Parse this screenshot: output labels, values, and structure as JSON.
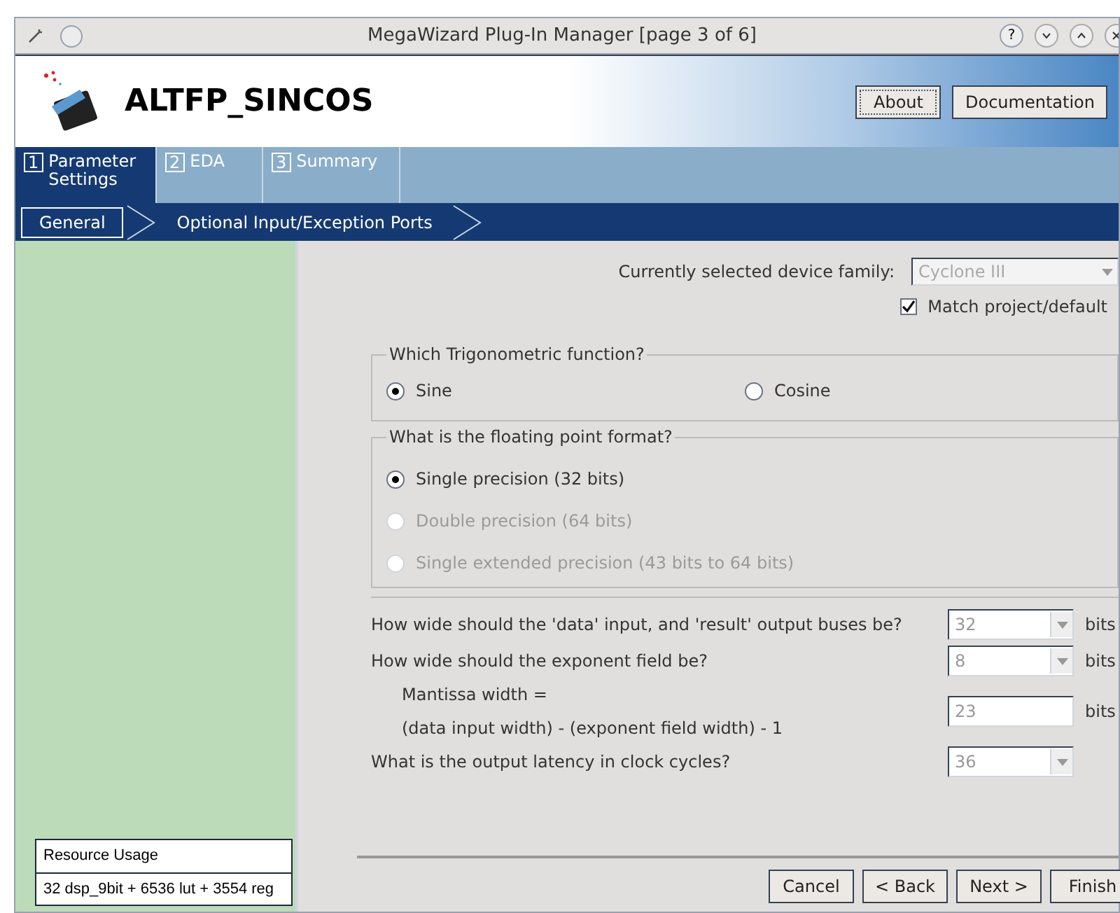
{
  "window": {
    "title": "MegaWizard Plug-In Manager [page 3 of 6]",
    "help": "?"
  },
  "header": {
    "title": "ALTFP_SINCOS",
    "buttons": [
      {
        "label": "About",
        "focused": true
      },
      {
        "label": "Documentation",
        "focused": false
      }
    ]
  },
  "tabs": [
    {
      "number": "1",
      "label": "Parameter Settings",
      "selected": true
    },
    {
      "number": "2",
      "label": "EDA",
      "selected": false
    },
    {
      "number": "3",
      "label": "Summary",
      "selected": false
    }
  ],
  "subtabs": [
    {
      "label": "General",
      "selected": true
    },
    {
      "label": "Optional Input/Exception Ports",
      "selected": false
    }
  ],
  "device": {
    "label": "Currently selected device family:",
    "value": "Cyclone III",
    "match_label": "Match project/default",
    "checked": true
  },
  "groups": [
    {
      "title": "Which Trigonometric function?",
      "kind": "row",
      "options": [
        {
          "label": "Sine",
          "selected": true,
          "disabled": false
        },
        {
          "label": "Cosine",
          "selected": false,
          "disabled": false
        }
      ]
    },
    {
      "title": "What is the floating point format?",
      "kind": "column",
      "options": [
        {
          "label": "Single precision (32 bits)",
          "selected": true,
          "disabled": false
        },
        {
          "label": "Double precision (64 bits)",
          "selected": false,
          "disabled": true
        },
        {
          "label": "Single extended precision (43 bits to 64 bits)",
          "selected": false,
          "disabled": true
        }
      ]
    }
  ],
  "settings": [
    {
      "kind": "dropdown",
      "label": "How wide should the 'data' input, and 'result' output buses be?",
      "value": "32",
      "unit": "bits",
      "disabled": true
    },
    {
      "kind": "dropdown",
      "label": "How wide should the exponent field be?",
      "value": "8",
      "unit": "bits",
      "disabled": true
    },
    {
      "kind": "text",
      "label": "Mantissa width =",
      "label2": "(data input width) - (exponent field width) - 1",
      "value": "23",
      "unit": "bits",
      "disabled": true
    },
    {
      "kind": "dropdown",
      "label": "What is the output latency in clock cycles?",
      "value": "36",
      "disabled": true
    }
  ],
  "resource": {
    "title": "Resource Usage",
    "value": "32 dsp_9bit + 6536 lut + 3554 reg"
  },
  "buttons": [
    "Cancel",
    "< Back",
    "Next >",
    "Finish"
  ]
}
